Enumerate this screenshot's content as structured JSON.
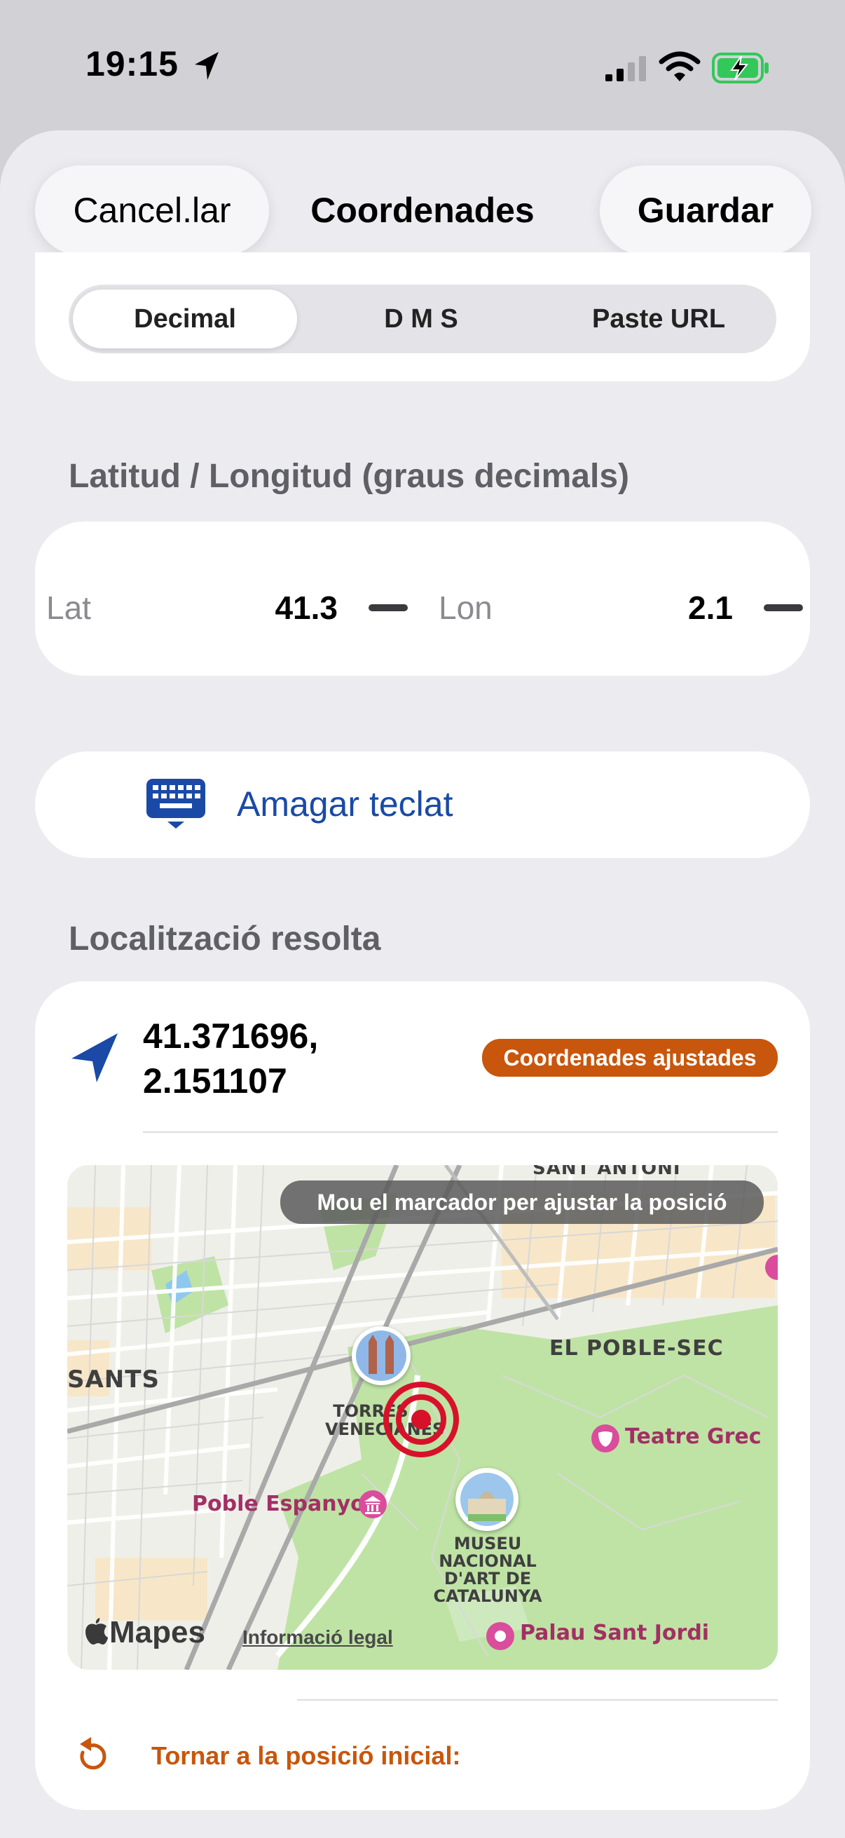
{
  "status_bar": {
    "time": "19:15"
  },
  "header": {
    "cancel_label": "Cancel.lar",
    "title": "Coordenades",
    "save_label": "Guardar"
  },
  "segments": {
    "items": [
      "Decimal",
      "D M S",
      "Paste URL"
    ],
    "selected": "Decimal"
  },
  "decimal_section": {
    "title": "Latitud / Longitud (graus decimals)",
    "lat_label": "Lat",
    "lat_value": "41.3",
    "lon_label": "Lon",
    "lon_value": "2.1"
  },
  "keyboard_button": {
    "label": "Amagar teclat"
  },
  "resolved": {
    "title": "Localització resolta",
    "coord_line1": "41.371696,",
    "coord_line2": "2.151107",
    "badge": "Coordenades ajustades"
  },
  "map": {
    "hint": "Mou el marcador per ajustar la posició",
    "labels": {
      "sant_antoni": "SANT ANTONI",
      "el_poble_sec": "EL POBLE-SEC",
      "sants": "SANTS",
      "torres_line1": "TORRES",
      "torres_line2": "VENECIANES",
      "teatre_grec": "Teatre Grec",
      "poble_espanyol": "Poble Espanyol",
      "museu_line1": "MUSEU",
      "museu_line2": "NACIONAL",
      "museu_line3": "D'ART DE",
      "museu_line4": "CATALUNYA",
      "palau": "Palau Sant Jordi"
    },
    "brand": "Mapes",
    "legal": "Informació legal"
  },
  "reset": {
    "label": "Tornar a la posició inicial:"
  },
  "colors": {
    "accent_blue": "#1a4aa6",
    "badge_orange": "#c8560c",
    "marker_red": "#d8112a",
    "battery_green": "#32c85a"
  }
}
